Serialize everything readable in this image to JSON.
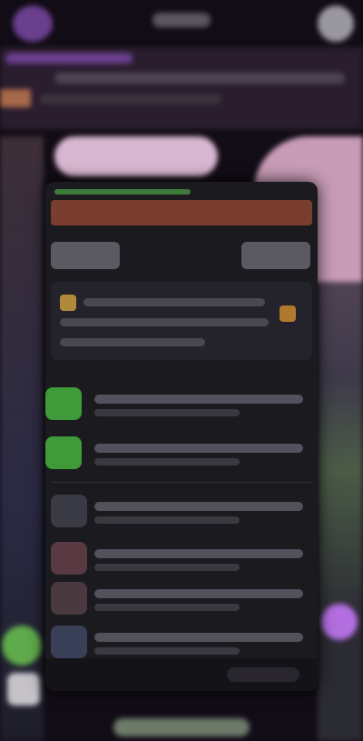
{
  "colors": {
    "background": "#120c16",
    "accent_purple": "#6a3f8e",
    "accent_green": "#3f9a3a",
    "accent_orange": "#7a3e2e",
    "sheet": "#1b1a1e",
    "fab_purple": "#b36ee0"
  },
  "icons": {
    "top_left": "avatar",
    "top_right": "menu-icon",
    "fab_left": "chat-icon",
    "fab_right": "plus-icon"
  },
  "sheet": {
    "headline": "",
    "left_button": "",
    "right_button": "",
    "rows": [
      {
        "icon_color": "#3f9a3a"
      },
      {
        "icon_color": "#3f9a3a"
      },
      {
        "icon_color": "#3a3a44"
      },
      {
        "icon_color": "#5a3a42"
      },
      {
        "icon_color": "#4a3a40"
      },
      {
        "icon_color": "#3a3f58"
      }
    ]
  }
}
